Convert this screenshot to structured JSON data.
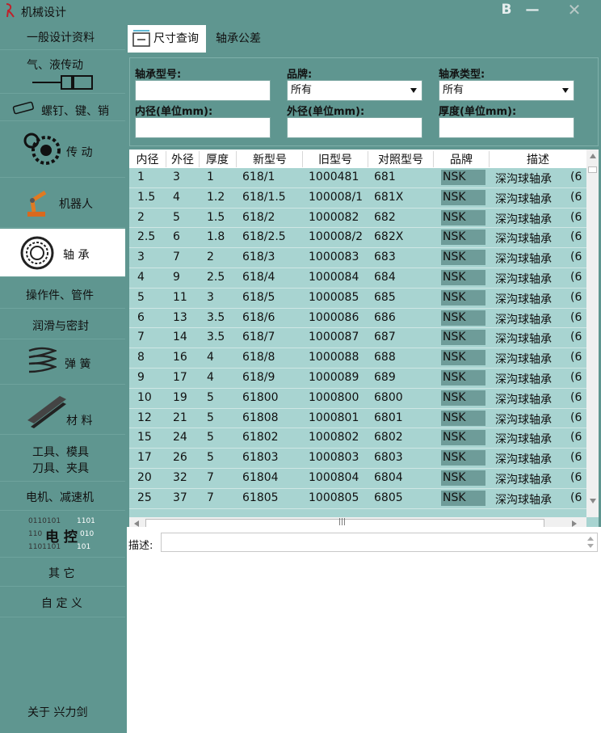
{
  "window": {
    "title": "机械设计",
    "btn_b": "B",
    "btn_min": "—",
    "btn_close": "✕"
  },
  "sidebar": {
    "items": [
      {
        "label": "一般设计资料"
      },
      {
        "label": "气、液传动"
      },
      {
        "label": "螺钉、键、销"
      },
      {
        "label": "传 动"
      },
      {
        "label": "机器人"
      },
      {
        "label": "轴 承"
      },
      {
        "label": "操作件、管件"
      },
      {
        "label": "润滑与密封"
      },
      {
        "label": "弹 簧"
      },
      {
        "label": "材 料"
      },
      {
        "label": "工具、模具",
        "label2": "刀具、夹具"
      },
      {
        "label": "电机、减速机"
      },
      {
        "label": "电 控",
        "bits1": "0110101",
        "bits1b": "1101",
        "bits2": "110",
        "bits2b": "010",
        "bits3": "1101101",
        "bits3b": "101"
      },
      {
        "label": "其 它"
      },
      {
        "label": "自 定 义"
      }
    ],
    "about": "关于 兴力剑"
  },
  "tabs": [
    {
      "label": "尺寸查询",
      "active": true
    },
    {
      "label": "轴承公差",
      "active": false
    }
  ],
  "filters": {
    "model_label": "轴承型号:",
    "brand_label": "品牌:",
    "brand_value": "所有",
    "type_label": "轴承类型:",
    "type_value": "所有",
    "inner_label": "内径(单位mm):",
    "outer_label": "外径(单位mm):",
    "thick_label": "厚度(单位mm):"
  },
  "table": {
    "headers": [
      "内径",
      "外径",
      "厚度",
      "新型号",
      "旧型号",
      "对照型号",
      "品牌",
      "描述"
    ],
    "rows": [
      [
        "1",
        "3",
        "1",
        "618/1",
        "1000481",
        "681",
        "NSK",
        "深沟球轴承",
        "(6"
      ],
      [
        "1.5",
        "4",
        "1.2",
        "618/1.5",
        "100008/1",
        "681X",
        "NSK",
        "深沟球轴承",
        "(6"
      ],
      [
        "2",
        "5",
        "1.5",
        "618/2",
        "1000082",
        "682",
        "NSK",
        "深沟球轴承",
        "(6"
      ],
      [
        "2.5",
        "6",
        "1.8",
        "618/2.5",
        "100008/2",
        "682X",
        "NSK",
        "深沟球轴承",
        "(6"
      ],
      [
        "3",
        "7",
        "2",
        "618/3",
        "1000083",
        "683",
        "NSK",
        "深沟球轴承",
        "(6"
      ],
      [
        "4",
        "9",
        "2.5",
        "618/4",
        "1000084",
        "684",
        "NSK",
        "深沟球轴承",
        "(6"
      ],
      [
        "5",
        "11",
        "3",
        "618/5",
        "1000085",
        "685",
        "NSK",
        "深沟球轴承",
        "(6"
      ],
      [
        "6",
        "13",
        "3.5",
        "618/6",
        "1000086",
        "686",
        "NSK",
        "深沟球轴承",
        "(6"
      ],
      [
        "7",
        "14",
        "3.5",
        "618/7",
        "1000087",
        "687",
        "NSK",
        "深沟球轴承",
        "(6"
      ],
      [
        "8",
        "16",
        "4",
        "618/8",
        "1000088",
        "688",
        "NSK",
        "深沟球轴承",
        "(6"
      ],
      [
        "9",
        "17",
        "4",
        "618/9",
        "1000089",
        "689",
        "NSK",
        "深沟球轴承",
        "(6"
      ],
      [
        "10",
        "19",
        "5",
        "61800",
        "1000800",
        "6800",
        "NSK",
        "深沟球轴承",
        "(6"
      ],
      [
        "12",
        "21",
        "5",
        "61808",
        "1000801",
        "6801",
        "NSK",
        "深沟球轴承",
        "(6"
      ],
      [
        "15",
        "24",
        "5",
        "61802",
        "1000802",
        "6802",
        "NSK",
        "深沟球轴承",
        "(6"
      ],
      [
        "17",
        "26",
        "5",
        "61803",
        "1000803",
        "6803",
        "NSK",
        "深沟球轴承",
        "(6"
      ],
      [
        "20",
        "32",
        "7",
        "61804",
        "1000804",
        "6804",
        "NSK",
        "深沟球轴承",
        "(6"
      ],
      [
        "25",
        "37",
        "7",
        "61805",
        "1000805",
        "6805",
        "NSK",
        "深沟球轴承",
        "(6"
      ]
    ]
  },
  "description": {
    "label": "描述:"
  },
  "colors": {
    "background": "#5f9690",
    "grid_row": "#a8d4d1",
    "brand_cell": "#6e9c99"
  }
}
